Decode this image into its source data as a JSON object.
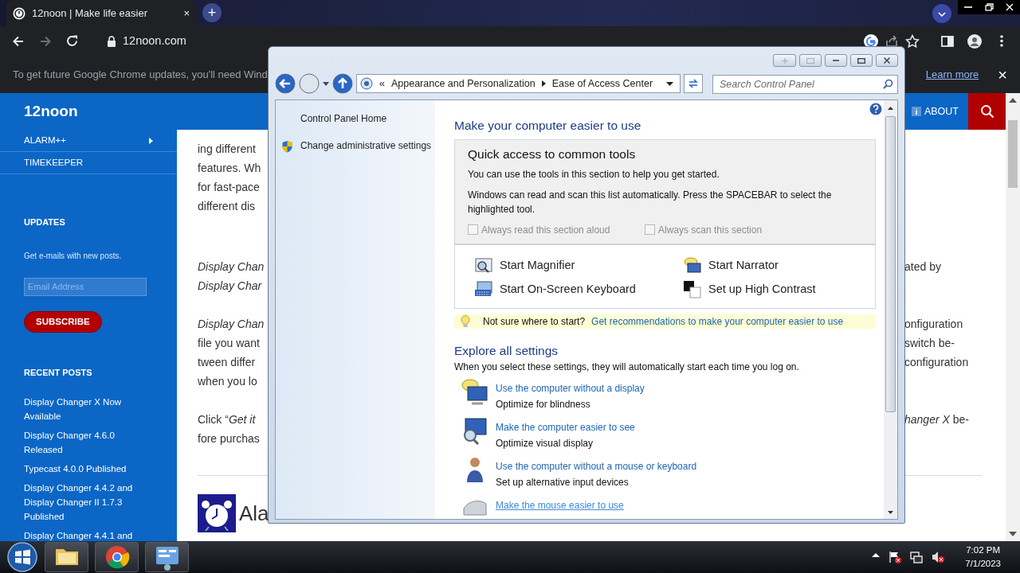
{
  "browser": {
    "tab_title": "12noon | Make life easier",
    "tab_close": "×",
    "new_tab": "+",
    "nav_buttons": [
      {
        "kind": "back",
        "disabled": false
      },
      {
        "kind": "forward",
        "disabled": true
      },
      {
        "kind": "reload",
        "disabled": false
      }
    ],
    "url": "12noon.com"
  },
  "infobar": {
    "message": "To get future Google Chrome updates, you'll need Wind",
    "link": "Learn more",
    "close": "×"
  },
  "site": {
    "logo": "12noon",
    "about": "ABOUT",
    "sidebar": {
      "menu": [
        {
          "label": "ALARM++",
          "has_submenu": true
        },
        {
          "label": "TIMEKEEPER",
          "has_submenu": false
        }
      ],
      "updates": {
        "heading": "UPDATES",
        "text": "Get e-mails with new posts.",
        "email_placeholder": "Email Address",
        "button": "SUBSCRIBE"
      },
      "recent_posts": {
        "heading": "RECENT POSTS",
        "posts": [
          "Display Changer X Now Available",
          "Display Changer 4.6.0 Released",
          "Typecast 4.0.0 Published",
          "Display Changer 4.4.2 and Display Changer II 1.7.3 Published",
          "Display Changer 4.4.1 and"
        ]
      }
    },
    "content": {
      "paragraphs": [
        {
          "lines": [
            {
              "left": "ing different",
              "italic": false
            },
            {
              "left": "features. Wh",
              "italic": false
            },
            {
              "left": "for fast-pace",
              "italic": false
            },
            {
              "left": "different dis",
              "italic": false
            }
          ]
        },
        {
          "lines": [
            {
              "left": "Display Chan",
              "italic": true,
              "right": "ated by"
            },
            {
              "left": "Display Char",
              "italic": true
            }
          ]
        },
        {
          "lines": [
            {
              "left": "Display Chan",
              "italic": true,
              "right": "onfiguration"
            },
            {
              "left": "file you want",
              "italic": false,
              "right": "switch be-"
            },
            {
              "left": "tween differ",
              "italic": false,
              "right": "configuration"
            },
            {
              "left": "when you lo",
              "italic": false
            }
          ]
        },
        {
          "lines": [
            {
              "left": "Click “*Get it*",
              "italic": false,
              "right": "*hanger X* be-"
            },
            {
              "left": "fore purchas",
              "italic": false
            }
          ]
        }
      ],
      "section_heading": "Ala"
    }
  },
  "control_panel": {
    "overflow": "«",
    "breadcrumb": [
      "Appearance and Personalization",
      "Ease of Access Center"
    ],
    "search_placeholder": "Search Control Panel",
    "tasks": [
      {
        "label": "Control Panel Home",
        "shield": false
      },
      {
        "label": "Change administrative settings",
        "shield": true
      }
    ],
    "title": "Make your computer easier to use",
    "quick_access": {
      "title": "Quick access to common tools",
      "intro": "You can use the tools in this section to help you get started.",
      "note": "Windows can read and scan this list automatically.  Press the SPACEBAR to select the highlighted tool.",
      "options": [
        {
          "label": "Always read this section aloud",
          "checked": false,
          "disabled": true
        },
        {
          "label": "Always scan this section",
          "checked": false,
          "disabled": true
        }
      ],
      "tools": [
        {
          "kind": "magnifier",
          "label": "Start Magnifier"
        },
        {
          "kind": "narrator",
          "label": "Start Narrator"
        },
        {
          "kind": "keyboard",
          "label": "Start On-Screen Keyboard"
        },
        {
          "kind": "contrast",
          "label": "Set up High Contrast"
        }
      ]
    },
    "tip": {
      "question": "Not sure where to start?",
      "link": "Get recommendations to make your computer easier to use"
    },
    "explore": {
      "title": "Explore all settings",
      "subtitle": "When you select these settings, they will automatically start each time you log on.",
      "items": [
        {
          "kind": "display",
          "link": "Use the computer without a display",
          "description": "Optimize for blindness",
          "hovered": false
        },
        {
          "kind": "see",
          "link": "Make the computer easier to see",
          "description": "Optimize visual display",
          "hovered": false
        },
        {
          "kind": "person",
          "link": "Use the computer without a mouse or keyboard",
          "description": "Set up alternative input devices",
          "hovered": false
        },
        {
          "kind": "mouse",
          "link": "Make the mouse easier to use",
          "hovered": true
        }
      ]
    }
  },
  "taskbar": {
    "time": "7:02 PM",
    "date": "7/1/2023"
  }
}
